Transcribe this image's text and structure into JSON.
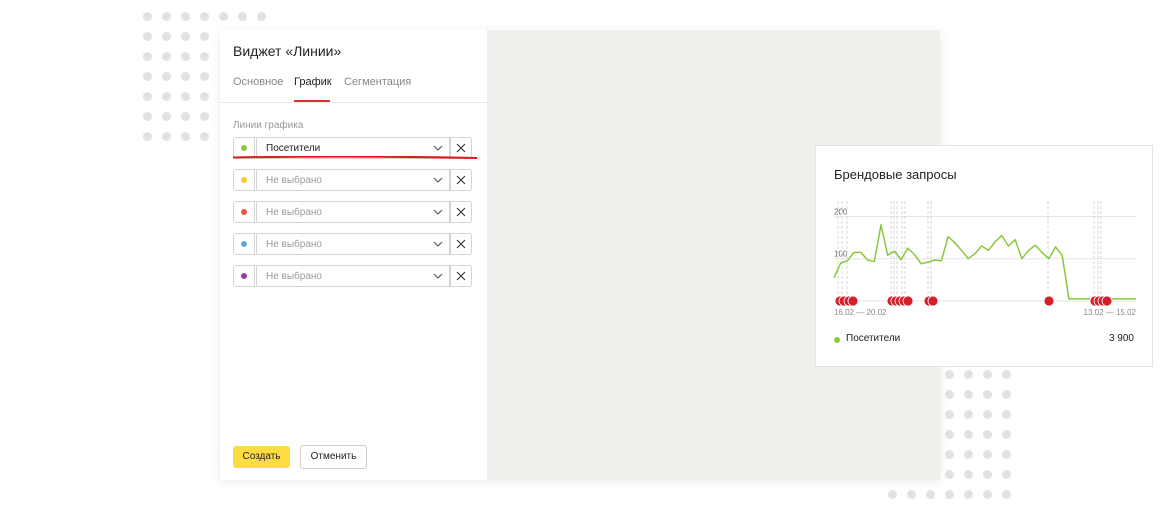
{
  "dialog": {
    "title": "Виджет «Линии»",
    "tabs": [
      {
        "label": "Основное",
        "active": false
      },
      {
        "label": "График",
        "active": true
      },
      {
        "label": "Сегментация",
        "active": false
      }
    ],
    "section_label": "Линии графика",
    "lines": [
      {
        "color": "#8cc63f",
        "value": "Посетители",
        "placeholder": false
      },
      {
        "color": "#fdc52f",
        "value": "Не выбрано",
        "placeholder": true
      },
      {
        "color": "#f0543c",
        "value": "Не выбрано",
        "placeholder": true
      },
      {
        "color": "#5ba8e0",
        "value": "Не выбрано",
        "placeholder": true
      },
      {
        "color": "#9b3aa8",
        "value": "Не выбрано",
        "placeholder": true
      }
    ],
    "create_label": "Создать",
    "cancel_label": "Отменить",
    "close_icon": "close-icon"
  },
  "preview": {
    "title": "Брендовые запросы",
    "legend": {
      "label": "Посетители",
      "value": "3 900",
      "color": "#8cc63f"
    }
  },
  "chart_data": {
    "type": "line",
    "title": "Брендовые запросы",
    "xlabel": "",
    "ylabel": "",
    "ylim": [
      0,
      220
    ],
    "y_ticks": [
      "200",
      "100"
    ],
    "x_tick_labels": [
      "16.02 — 20.02",
      "13.02 — 15.02"
    ],
    "grid": true,
    "series": [
      {
        "name": "Посетители",
        "color": "#8cc63f",
        "values": [
          55,
          90,
          95,
          115,
          115,
          97,
          93,
          180,
          108,
          118,
          98,
          125,
          110,
          88,
          92,
          97,
          95,
          152,
          138,
          120,
          100,
          112,
          130,
          120,
          140,
          155,
          130,
          145,
          100,
          120,
          132,
          115,
          100,
          128,
          108,
          5,
          5,
          5,
          5,
          5,
          5,
          5,
          5,
          5,
          5,
          5
        ]
      }
    ],
    "annotation_marker_count": 18,
    "annotation_color": "#d5202b",
    "legend": {
      "position": "bottom-left",
      "entries": [
        "Посетители"
      ],
      "total": "3 900"
    }
  }
}
